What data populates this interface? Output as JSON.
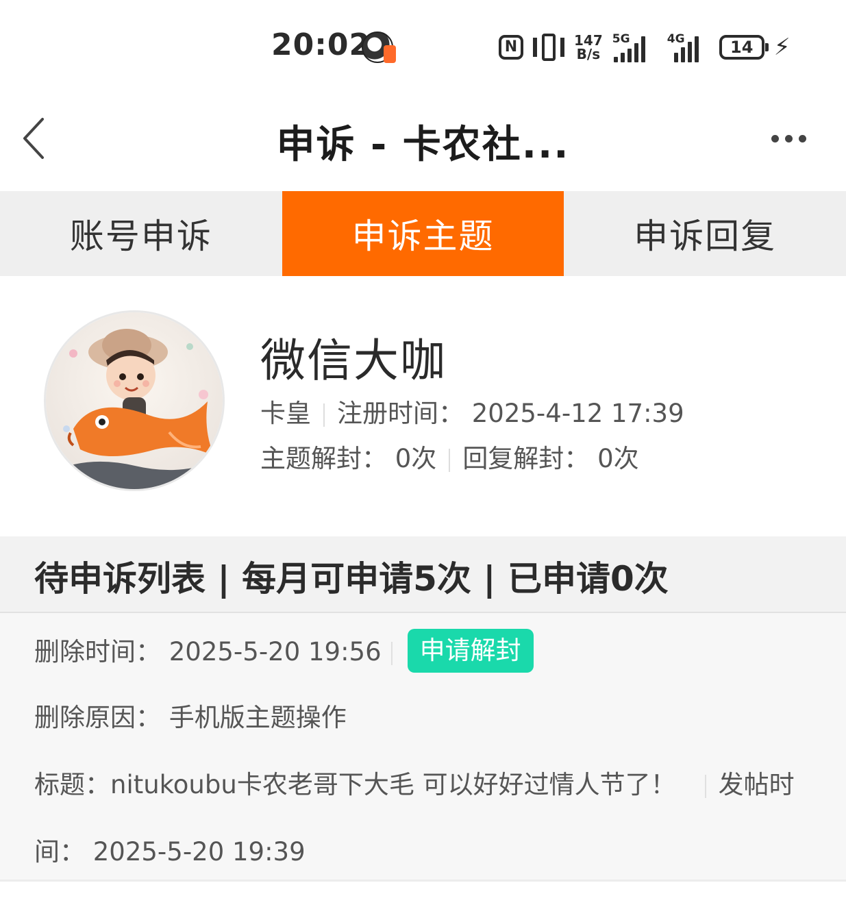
{
  "status_bar": {
    "time": "20:02",
    "nfc": "N",
    "net_speed_value": "147",
    "net_speed_unit": "B/s",
    "sim1_label": "5G",
    "sim2_label": "4G",
    "battery": "14",
    "icons": [
      "nfc-icon",
      "vibrate-icon",
      "signal-5g-icon",
      "signal-4g-icon",
      "battery-icon",
      "charging-bolt-icon"
    ]
  },
  "header": {
    "title": "申诉 - 卡农社...",
    "back_icon": "chevron-left-icon",
    "more_icon": "more-dots-icon"
  },
  "tabs": [
    {
      "label": "账号申诉",
      "active": false
    },
    {
      "label": "申诉主题",
      "active": true
    },
    {
      "label": "申诉回复",
      "active": false
    }
  ],
  "profile": {
    "username": "微信大咖",
    "level": "卡皇",
    "register_time": "注册时间：  2025-4-12 17:39",
    "topic_unban": "主题解封：  0次",
    "reply_unban": "回复解封：  0次"
  },
  "list": {
    "header": "待申诉列表 | 每月可申请5次 | 已申请0次",
    "items": [
      {
        "delete_time": "删除时间：  2025-5-20 19:56",
        "action_label": "申请解封",
        "delete_reason": "删除原因：  手机版主题操作",
        "title_line": "标题：nitukoubu卡农老哥下大毛 可以好好过情人节了！",
        "post_time_prefix": "发帖时",
        "post_time_line": "间：  2025-5-20 19:39"
      }
    ]
  },
  "colors": {
    "accent": "#ff6a00",
    "action": "#1ad9ab",
    "tab_bg": "#efefef"
  }
}
